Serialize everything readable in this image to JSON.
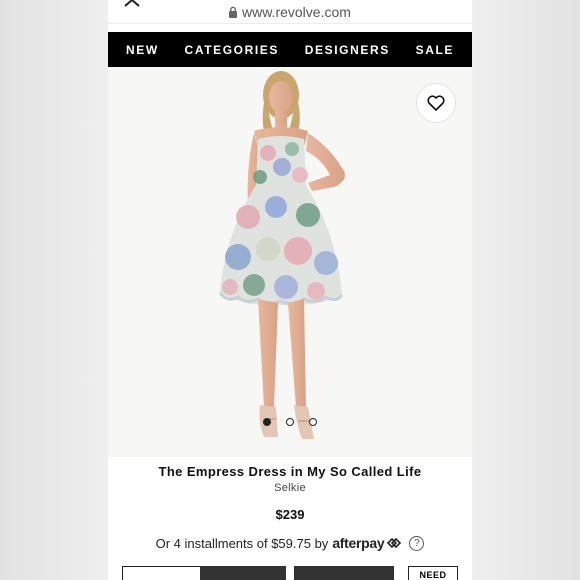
{
  "browser": {
    "url": "www.revolve.com",
    "close_icon": "close-icon",
    "lock_icon": "lock-icon"
  },
  "nav": {
    "items": [
      "NEW",
      "CATEGORIES",
      "DESIGNERS",
      "SALE"
    ]
  },
  "product": {
    "image_description_icon": "model-in-floral-dress",
    "wishlist_icon": "heart-icon",
    "carousel_count": 3,
    "carousel_active": 1,
    "title": "The Empress Dress in My So Called Life",
    "brand": "Selkie",
    "price": "$239",
    "installments_text": "Or 4 installments of $59.75 by",
    "afterpay_label": "afterpay",
    "help_label": "?"
  },
  "actions": {
    "need_help_label": "NEED"
  },
  "colors": {
    "nav_bg": "#000000",
    "nav_text": "#ffffff",
    "accent_dark": "#333333"
  }
}
